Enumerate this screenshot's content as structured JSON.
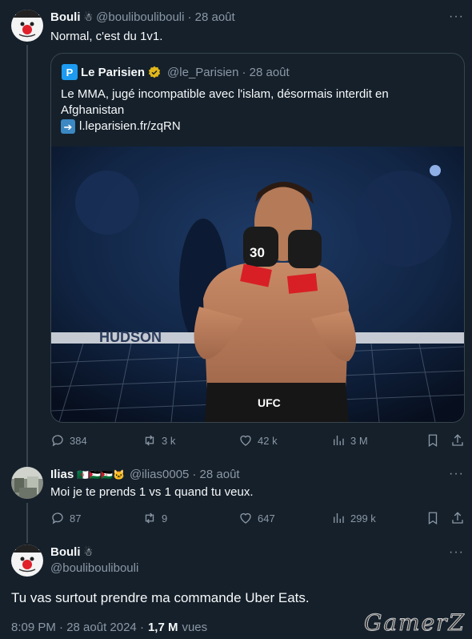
{
  "tweet1": {
    "name": "Bouli",
    "handle": "@bouliboulibouli",
    "date": "· 28 août",
    "text": "Normal, c'est du 1v1.",
    "more": "···"
  },
  "quote": {
    "name": "Le Parisien",
    "handle": "@le_Parisien",
    "date": "· 28 août",
    "text_line1": "Le MMA, jugé incompatible avec l'islam, désormais interdit en",
    "text_line2": "Afghanistan",
    "link": "l.leparisien.fr/zqRN",
    "logo_letter": "P",
    "photo_banner_text": "HUDSON",
    "glove_number": "30",
    "shorts_logo": "UFC"
  },
  "tweet1_actions": {
    "replies": "384",
    "retweets": "3 k",
    "likes": "42 k",
    "views": "3 M"
  },
  "tweet2": {
    "name": "Ilias",
    "flags": "🇩🇿🇵🇸🇪🇭🐱",
    "handle": "@ilias0005",
    "date": "· 28 août",
    "text": "Moi je te prends 1 vs 1 quand tu veux.",
    "more": "···"
  },
  "tweet2_actions": {
    "replies": "87",
    "retweets": "9",
    "likes": "647",
    "views": "299 k"
  },
  "tweet3": {
    "name": "Bouli",
    "handle": "@bouliboulibouli",
    "text": "Tu vas surtout prendre ma commande Uber Eats.",
    "timestamp": "8:09 PM · 28 août 2024 ·",
    "views_count": "1,7 M",
    "views_label": "vues",
    "more": "···"
  },
  "watermark": "GamerZ",
  "colors": {
    "background": "#15202b",
    "border": "#38444d",
    "muted": "#8b98a5",
    "text": "#f7f9f9",
    "verified": "#e2b719"
  }
}
